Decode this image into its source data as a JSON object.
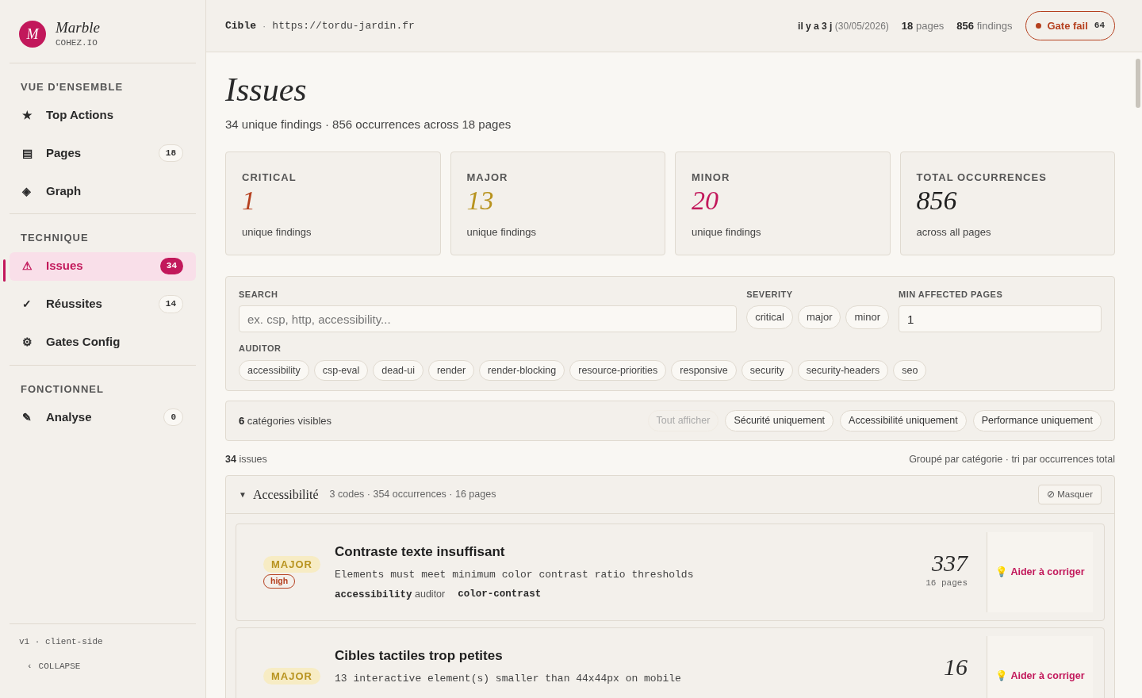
{
  "brand": {
    "initial": "M",
    "name": "Marble",
    "subtitle": "COHEZ.IO"
  },
  "sidebar": {
    "sections": [
      {
        "title": "VUE D'ENSEMBLE",
        "items": [
          {
            "icon": "★",
            "label": "Top Actions",
            "selected": false
          },
          {
            "icon": "▤",
            "label": "Pages",
            "count": "18",
            "selected": false
          },
          {
            "icon": "◈",
            "label": "Graph",
            "selected": false
          }
        ]
      },
      {
        "title": "TECHNIQUE",
        "items": [
          {
            "icon": "⚠",
            "label": "Issues",
            "count": "34",
            "selected": true
          },
          {
            "icon": "✓",
            "label": "Réussites",
            "count": "14",
            "selected": false
          },
          {
            "icon": "⚙",
            "label": "Gates Config",
            "selected": false
          }
        ]
      },
      {
        "title": "FONCTIONNEL",
        "items": [
          {
            "icon": "✎",
            "label": "Analyse",
            "count": "0",
            "selected": false
          }
        ]
      }
    ],
    "version": "v1 · client-side",
    "collapse": {
      "icon": "‹",
      "label": "COLLAPSE"
    }
  },
  "header": {
    "target_label": "Cible",
    "separator": "·",
    "target_url": "https://tordu-jardin.fr",
    "age": "il y a 3 j",
    "date": "(30/05/2026)",
    "pages": "18",
    "pages_label": "pages",
    "findings": "856",
    "findings_label": "findings",
    "gate": {
      "label": "Gate fail",
      "score": "64"
    }
  },
  "title": "Issues",
  "subtitle": "34 unique findings · 856 occurrences across 18 pages",
  "stats": [
    {
      "label": "CRITICAL",
      "value": "1",
      "caption": "unique findings",
      "color": "#b5401f"
    },
    {
      "label": "MAJOR",
      "value": "13",
      "caption": "unique findings",
      "color": "#b8931f"
    },
    {
      "label": "MINOR",
      "value": "20",
      "caption": "unique findings",
      "color": "#c2185b"
    },
    {
      "label": "TOTAL OCCURRENCES",
      "value": "856",
      "caption": "across all pages",
      "color": "#1f1f1f"
    }
  ],
  "filters": {
    "search_label": "SEARCH",
    "search_placeholder": "ex. csp, http, accessibility...",
    "severity_label": "SEVERITY",
    "severities": [
      "critical",
      "major",
      "minor"
    ],
    "min_pages_label": "MIN AFFECTED PAGES",
    "min_pages": "1",
    "auditor_label": "AUDITOR",
    "auditors": [
      "accessibility",
      "csp-eval",
      "dead-ui",
      "render",
      "render-blocking",
      "resource-priorities",
      "responsive",
      "security",
      "security-headers",
      "seo"
    ]
  },
  "categories_bar": {
    "count": "6",
    "label": "catégories visibles",
    "buttons": [
      {
        "label": "Tout afficher",
        "disabled": true
      },
      {
        "label": "Sécurité uniquement",
        "disabled": false
      },
      {
        "label": "Accessibilité uniquement",
        "disabled": false
      },
      {
        "label": "Performance uniquement",
        "disabled": false
      }
    ]
  },
  "summary": {
    "count": "34",
    "label": "issues",
    "sort": "Groupé par catégorie · tri par occurrences total"
  },
  "group": {
    "expanded": true,
    "toggle_icon": "▼",
    "hide_icon": "⊘",
    "name": "Accessibilité",
    "meta": "3 codes · 354 occurrences · 16 pages",
    "hide_label": "Masquer",
    "issues": [
      {
        "severity": "MAJOR",
        "impact": "high",
        "title": "Contraste texte insuffisant",
        "description": "Elements must meet minimum color contrast ratio thresholds",
        "auditor": "accessibility",
        "auditor_label": "auditor",
        "code": "color-contrast",
        "count": "337",
        "pages": "16 pages",
        "action_icon": "💡",
        "action": "Aider à corriger"
      },
      {
        "severity": "MAJOR",
        "title": "Cibles tactiles trop petites",
        "description": "13 interactive element(s) smaller than 44x44px on mobile",
        "count": "16",
        "action_icon": "💡",
        "action": "Aider à corriger"
      }
    ]
  }
}
